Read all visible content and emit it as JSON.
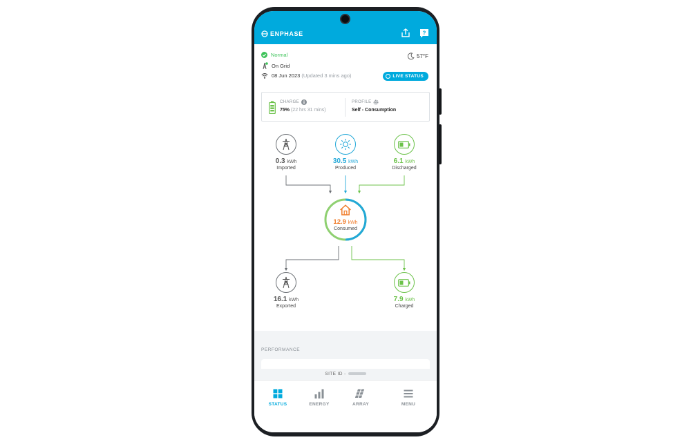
{
  "app": {
    "brand": "ENPHASE"
  },
  "status": {
    "system": "Normal",
    "grid": "On Grid",
    "date": "08 Jun 2023",
    "updated": "(Updated 3 mins ago)",
    "temperature": "57°F",
    "live_label": "LIVE STATUS"
  },
  "battery_card": {
    "charge_label": "CHARGE",
    "charge_percent": "75%",
    "charge_time": "(22 hrs 31 mins)",
    "profile_label": "PROFILE",
    "profile_value": "Self - Consumption"
  },
  "flow": {
    "imported": {
      "value": "0.3",
      "unit": "kWh",
      "label": "Imported"
    },
    "produced": {
      "value": "30.5",
      "unit": "kWh",
      "label": "Produced"
    },
    "discharged": {
      "value": "6.1",
      "unit": "kWh",
      "label": "Discharged"
    },
    "consumed": {
      "value": "12.9",
      "unit": "kWh",
      "label": "Consumed"
    },
    "exported": {
      "value": "16.1",
      "unit": "kWh",
      "label": "Exported"
    },
    "charged": {
      "value": "7.9",
      "unit": "kWh",
      "label": "Charged"
    }
  },
  "performance": {
    "title": "PERFORMANCE"
  },
  "site": {
    "label": "SITE ID -"
  },
  "tabs": [
    {
      "label": "STATUS",
      "icon": "grid-icon",
      "active": true
    },
    {
      "label": "ENERGY",
      "icon": "bar-chart-icon",
      "active": false
    },
    {
      "label": "ARRAY",
      "icon": "panels-icon",
      "active": false
    },
    {
      "label": "MENU",
      "icon": "menu-icon",
      "active": false
    }
  ],
  "colors": {
    "brand": "#00aadd",
    "solar": "#22a8d8",
    "battery": "#6cc24a",
    "consumed": "#f07c2a",
    "grid": "#6b6f74",
    "ok": "#3ec35a"
  }
}
